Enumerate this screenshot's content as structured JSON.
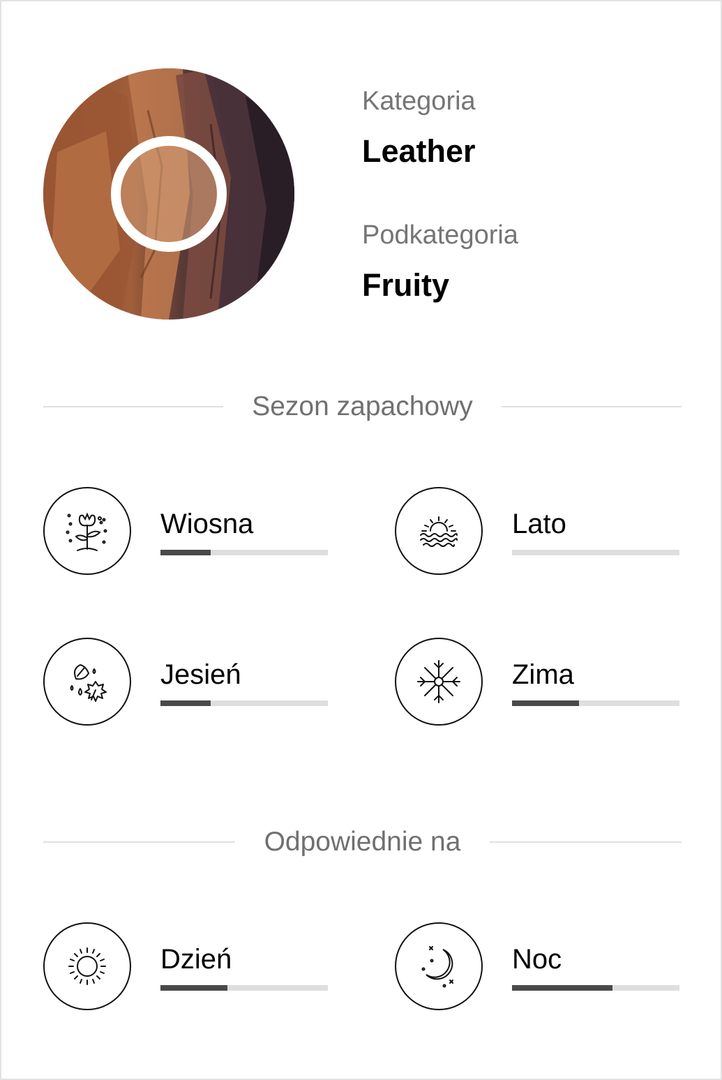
{
  "header": {
    "category_label": "Kategoria",
    "category_value": "Leather",
    "subcategory_label": "Podkategoria",
    "subcategory_value": "Fruity"
  },
  "seasons": {
    "title": "Sezon zapachowy",
    "items": [
      {
        "label": "Wiosna",
        "icon": "spring-flower-icon",
        "level": 0.3
      },
      {
        "label": "Lato",
        "icon": "summer-sun-waves-icon",
        "level": 0.0
      },
      {
        "label": "Jesień",
        "icon": "autumn-leaves-icon",
        "level": 0.3
      },
      {
        "label": "Zima",
        "icon": "winter-snowflake-icon",
        "level": 0.4
      }
    ]
  },
  "time_of_day": {
    "title": "Odpowiednie na",
    "items": [
      {
        "label": "Dzień",
        "icon": "sun-icon",
        "level": 0.4
      },
      {
        "label": "Noc",
        "icon": "moon-icon",
        "level": 0.6
      }
    ]
  },
  "colors": {
    "bar_fill": "#4a4a4a",
    "bar_track": "#dedede",
    "muted_text": "#757575"
  }
}
